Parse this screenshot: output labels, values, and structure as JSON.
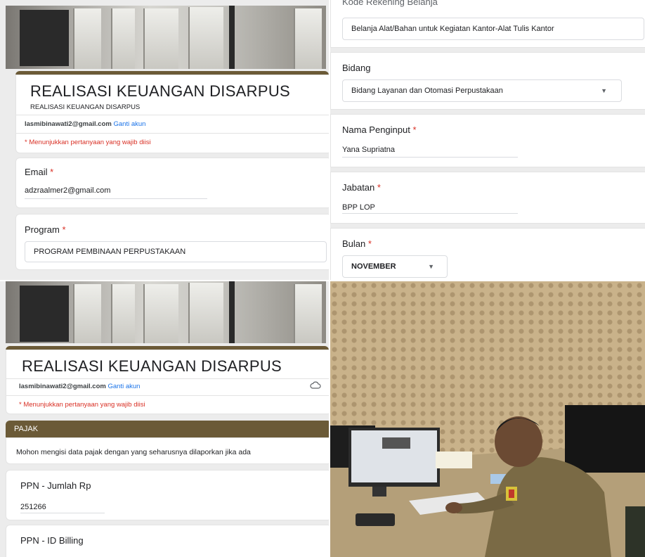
{
  "panel1": {
    "form_title": "REALISASI KEUANGAN DISARPUS",
    "form_subtitle": "REALISASI KEUANGAN DISARPUS",
    "account_email": "lasmibinawati2@gmail.com",
    "switch_account": "Ganti akun",
    "required_note": "* Menunjukkan pertanyaan yang wajib diisi",
    "email_label": "Email",
    "email_value": "adzraalmer2@gmail.com",
    "program_label": "Program",
    "program_value": "PROGRAM PEMBINAAN PERPUSTAKAAN",
    "required_star": "*"
  },
  "panel2": {
    "cut_label": "Kode Rekening Belanja",
    "belanja_value": "Belanja Alat/Bahan untuk Kegiatan Kantor-Alat Tulis Kantor",
    "bidang_label": "Bidang",
    "bidang_value": "Bidang Layanan dan Otomasi Perpustakaan",
    "penginput_label": "Nama Penginput",
    "penginput_value": "Yana Supriatna",
    "jabatan_label": "Jabatan",
    "jabatan_value": "BPP LOP",
    "bulan_label": "Bulan",
    "bulan_value": "NOVEMBER",
    "required_star": "*"
  },
  "panel3": {
    "form_title": "REALISASI KEUANGAN DISARPUS",
    "account_email": "lasmibinawati2@gmail.com",
    "switch_account": "Ganti akun",
    "required_note": "* Menunjukkan pertanyaan yang wajib diisi",
    "section_title": "PAJAK",
    "section_desc": "Mohon mengisi  data pajak dengan yang seharusnya dilaporkan jika ada",
    "ppn_amount_label": "PPN - Jumlah Rp",
    "ppn_amount_value": "251266",
    "ppn_billing_label": "PPN - ID Billing"
  },
  "icons": {
    "cloud": "cloud-icon",
    "dropdown": "caret-down-icon"
  },
  "colors": {
    "accent_brown": "#6b5a37",
    "required_red": "#d93025",
    "link_blue": "#1a73e8"
  }
}
